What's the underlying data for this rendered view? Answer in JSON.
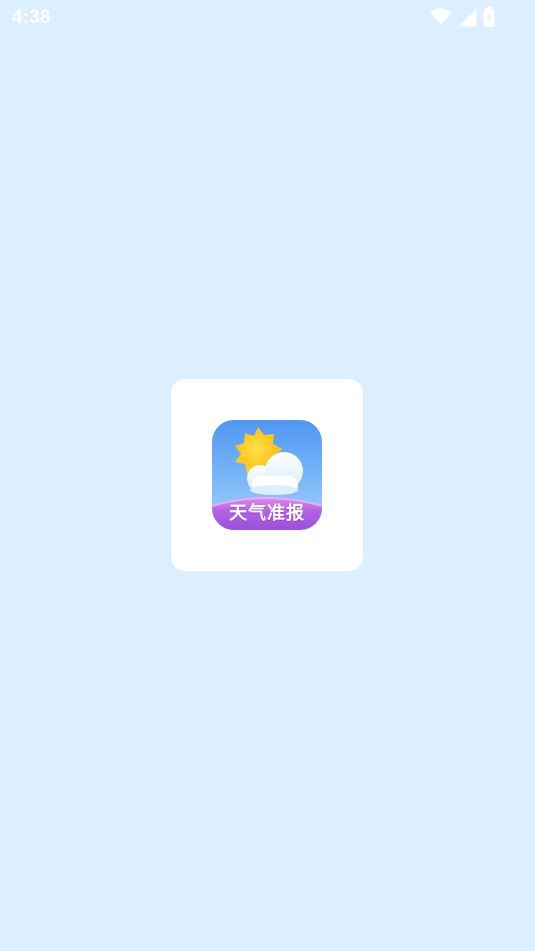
{
  "status_bar": {
    "time": "4:38",
    "icons": [
      "wifi-icon",
      "cellular-signal-icon",
      "battery-charging-icon"
    ],
    "icon_color": "#ffffff"
  },
  "splash": {
    "background_color": "#dcefff",
    "card_color": "#ffffff",
    "app_icon": {
      "label": "天气准报",
      "graphics": [
        "sun-icon",
        "cloud-icon"
      ],
      "gradient_top": "#5aa0f5",
      "gradient_bottom": "#b96fe6"
    }
  }
}
